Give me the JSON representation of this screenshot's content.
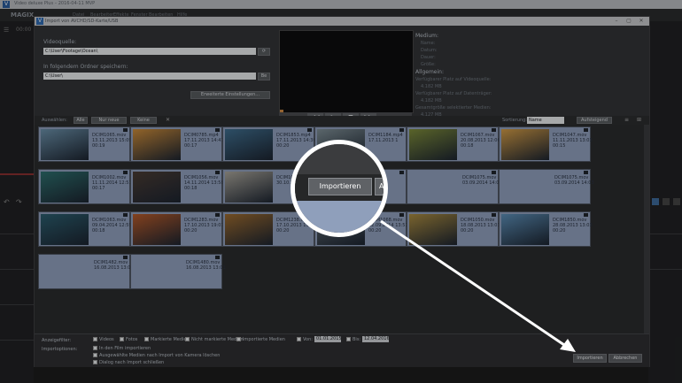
{
  "app": {
    "title": "Video deluxe Plus – 2016-04-11 MVP",
    "brand": "MAGIX",
    "timecode": "00:00"
  },
  "menu": [
    "Datei",
    "Bearbeiten",
    "Effekte",
    "Fenster",
    "Bearbeiten",
    "Hilfe"
  ],
  "dialog": {
    "title": "Import von AVCHD/SD-Karte/USB",
    "video_source_label": "Videoquelle:",
    "video_source_value": "C:\\User\\Footage\\Ocean\\",
    "save_folder_label": "In folgendem Ordner speichern:",
    "save_folder_value": "C:\\User\\",
    "browse_label": "Be",
    "advanced_label": "Erweiterte Einstellungen..."
  },
  "info": {
    "medium_title": "Medium:",
    "medium_rows": [
      "Name:",
      "Datum:",
      "Dauer:",
      "Größe:"
    ],
    "general_title": "Allgemein:",
    "general_rows": [
      "Verfügbarer Platz auf Videoquelle:",
      "4.182 MB",
      "Verfügbarer Platz auf Datenträger:",
      "4.182 MB",
      "Gesamtgröße selektierter Medien:",
      "4.127 MB"
    ]
  },
  "toolbar": {
    "select_label": "Auswählen:",
    "all": "Alle",
    "new": "Nur neue",
    "none": "Keine",
    "sort_label": "Sortierung:",
    "sort_value": "Name",
    "order": "Aufsteigend"
  },
  "tiles": [
    {
      "name": "DCIM1065.mov",
      "date": "13.11.2013 15:09",
      "dur": "00:19",
      "color": "#6a8fa8"
    },
    {
      "name": "DCIM0785.mp4",
      "date": "17.11.2013 14:47",
      "dur": "00:17",
      "color": "#c98a3a"
    },
    {
      "name": "DCIM1853.mp4",
      "date": "17.11.2013 14:36",
      "dur": "00:20",
      "color": "#3f6d8d"
    },
    {
      "name": "DCIM1184.mp4",
      "date": "17.11.2013 1",
      "dur": "",
      "color": "#7d8d94"
    },
    {
      "name": "DCIM1067.mov",
      "date": "20.08.2013 12:06",
      "dur": "00:18",
      "color": "#7c8a3a"
    },
    {
      "name": "DCIM1047.mov",
      "date": "11.11.2013 13:03",
      "dur": "00:15",
      "color": "#d09a46"
    },
    {
      "name": "DCIM1002.mov",
      "date": "11.11.2014 12:51",
      "dur": "00:17",
      "color": "#2e6f6e"
    },
    {
      "name": "DCIM1056.mov",
      "date": "14.11.2014 13:58",
      "dur": "00:18",
      "color": "#4a3c34"
    },
    {
      "name": "DCIM1047.mov",
      "date": "30.10.2",
      "dur": "",
      "color": "#a8a49a"
    },
    {
      "name": "",
      "date": "",
      "dur": "",
      "color": "#8f9fbb"
    },
    {
      "name": "DCIM1075.mov",
      "date": "03.09.2014 14:03",
      "dur": "",
      "color": ""
    },
    {
      "name": "DCIM1075.mov",
      "date": "03.09.2014 14:03",
      "dur": "",
      "color": ""
    },
    {
      "name": "DCIM1063.mov",
      "date": "09.04.2014 12:59",
      "dur": "00:18",
      "color": "#2b5d6e"
    },
    {
      "name": "DCIM1283.mov",
      "date": "17.10.2013 19:07",
      "dur": "00:20",
      "color": "#b55a2a"
    },
    {
      "name": "DCIM1238.mov",
      "date": "17.10.2013 19:07",
      "dur": "00:20",
      "color": "#9b6a30"
    },
    {
      "name": "DCIM1068.mov",
      "date": "12.09.2014 13:51",
      "dur": "00:20",
      "color": "#5f6a74"
    },
    {
      "name": "DCIM1050.mov",
      "date": "18.08.2013 13:03",
      "dur": "00:20",
      "color": "#a88a40"
    },
    {
      "name": "DCIM1850.mov",
      "date": "28.08.2013 13:03",
      "dur": "00:20",
      "color": "#5b8db5"
    },
    {
      "name": "DCIM1482.mov",
      "date": "16.08.2013 13:01",
      "dur": "",
      "color": ""
    },
    {
      "name": "DCIM1480.mov",
      "date": "16.08.2013 13:01",
      "dur": "",
      "color": ""
    }
  ],
  "footer": {
    "show_label": "Anzeigefilter:",
    "filters": [
      "Videos",
      "Fotos",
      "Markierte Medien",
      "Nicht markierte Medien",
      "Importierte Medien"
    ],
    "from_label": "Von:",
    "from_value": "01.01.2015",
    "to_label": "Bis:",
    "to_value": "12.04.2016",
    "import_options_label": "Importoptionen:",
    "options": [
      "In den Film importieren",
      "Ausgewählte Medien nach Import von Kamera löschen",
      "Dialog nach Import schließen"
    ],
    "import_button": "Importieren",
    "cancel_button": "Abbrechen"
  },
  "magnifier": {
    "import_button": "Importieren",
    "next_button": "A"
  }
}
